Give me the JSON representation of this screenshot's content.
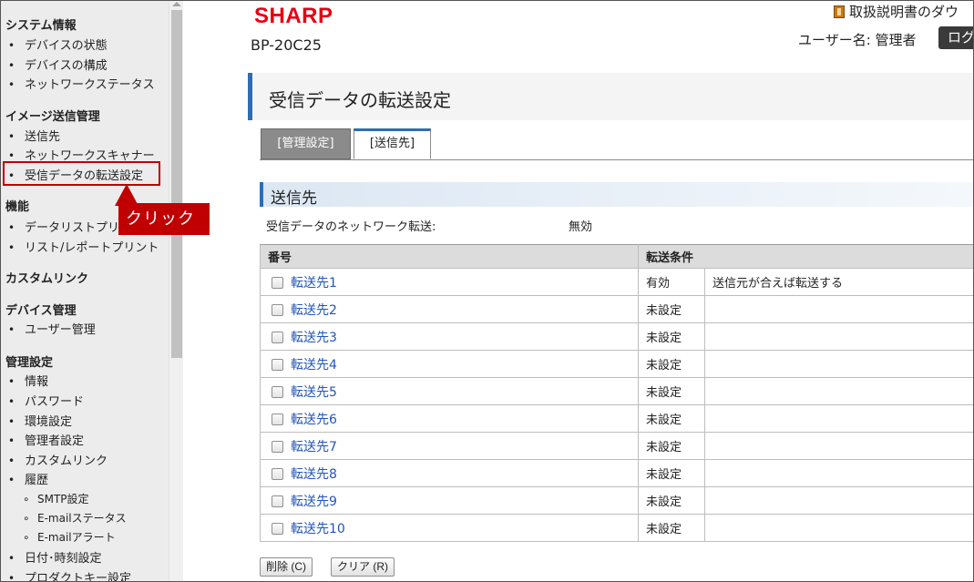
{
  "sidebar": {
    "sections": [
      {
        "title": "システム情報",
        "items": [
          "デバイスの状態",
          "デバイスの構成",
          "ネットワークステータス"
        ]
      },
      {
        "title": "イメージ送信管理",
        "items": [
          "送信先",
          "ネットワークスキャナー",
          "受信データの転送設定"
        ]
      },
      {
        "title": "機能",
        "items": [
          "データリストプリント",
          "リスト/レポートプリント"
        ]
      },
      {
        "title": "カスタムリンク",
        "items": []
      },
      {
        "title": "デバイス管理",
        "items": [
          "ユーザー管理"
        ]
      },
      {
        "title": "管理設定",
        "items": [
          "情報",
          "パスワード",
          "環境設定",
          "管理者設定",
          "カスタムリンク",
          "履歴",
          "日付･時刻設定",
          "プロダクトキー設定"
        ],
        "sub_items": [
          "SMTP設定",
          "E-mailステータス",
          "E-mailアラート"
        ]
      }
    ]
  },
  "callout": {
    "text": "クリック"
  },
  "header": {
    "brand": "SHARP",
    "model": "BP-20C25",
    "manual_link": "取扱説明書のダウ",
    "user_label": "ユーザー名: 管理者",
    "logout_label": "ログ"
  },
  "page": {
    "title": "受信データの転送設定"
  },
  "tabs": [
    {
      "label": "[管理設定]",
      "active": false
    },
    {
      "label": "[送信先]",
      "active": true
    }
  ],
  "section": {
    "title": "送信先",
    "forward_label": "受信データのネットワーク転送:",
    "forward_value": "無効"
  },
  "table": {
    "headers": [
      "番号",
      "転送条件"
    ],
    "rows": [
      {
        "name": "転送先1",
        "status": "有効",
        "condition": "送信元が合えば転送する"
      },
      {
        "name": "転送先2",
        "status": "未設定",
        "condition": ""
      },
      {
        "name": "転送先3",
        "status": "未設定",
        "condition": ""
      },
      {
        "name": "転送先4",
        "status": "未設定",
        "condition": ""
      },
      {
        "name": "転送先5",
        "status": "未設定",
        "condition": ""
      },
      {
        "name": "転送先6",
        "status": "未設定",
        "condition": ""
      },
      {
        "name": "転送先7",
        "status": "未設定",
        "condition": ""
      },
      {
        "name": "転送先8",
        "status": "未設定",
        "condition": ""
      },
      {
        "name": "転送先9",
        "status": "未設定",
        "condition": ""
      },
      {
        "name": "転送先10",
        "status": "未設定",
        "condition": ""
      }
    ]
  },
  "buttons": {
    "delete_label": "削除 (C)",
    "clear_label": "クリア (R)"
  },
  "colors": {
    "brand": "#e60012",
    "accent": "#2d6db5",
    "highlight": "#c00000",
    "link": "#2255bb"
  }
}
